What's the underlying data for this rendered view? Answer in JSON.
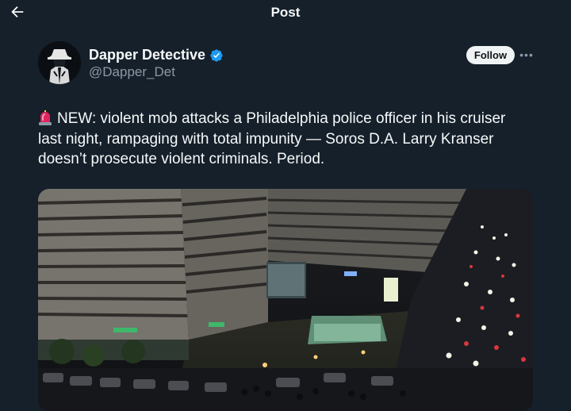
{
  "header": {
    "title": "Post",
    "back_icon": "arrow-left-icon"
  },
  "author": {
    "name": "Dapper Detective",
    "handle": "@Dapper_Det",
    "verified_icon": "verified-badge-icon",
    "verified_color": "#1d9bf0"
  },
  "actions": {
    "follow_label": "Follow",
    "more_icon": "more-options-icon"
  },
  "tweet": {
    "emoji_icon": "police-siren-icon",
    "text": "NEW: violent mob attacks a Philadelphia police officer in his cruiser last night, rampaging with total impunity — Soros D.A. Larry Kranser doesn’t prosecute violent criminals. Period."
  },
  "colors": {
    "background": "#15202b",
    "text": "#f7f9f9",
    "secondary": "#8b98a5",
    "button_bg": "#eff3f4"
  }
}
